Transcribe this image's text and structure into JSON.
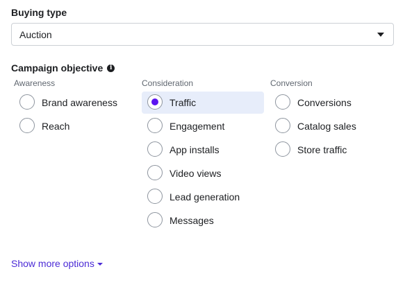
{
  "buying_type": {
    "title": "Buying type",
    "selected": "Auction"
  },
  "objective": {
    "title": "Campaign objective",
    "info_icon": "info-icon",
    "columns": {
      "awareness": {
        "header": "Awareness",
        "options": [
          "Brand awareness",
          "Reach"
        ]
      },
      "consideration": {
        "header": "Consideration",
        "options": [
          "Traffic",
          "Engagement",
          "App installs",
          "Video views",
          "Lead generation",
          "Messages"
        ]
      },
      "conversion": {
        "header": "Conversion",
        "options": [
          "Conversions",
          "Catalog sales",
          "Store traffic"
        ]
      }
    },
    "selected": "Traffic",
    "colors": {
      "selected_bg": "#e7edfa",
      "radio_dot": "#5b14f0",
      "link": "#4b2bd6"
    }
  },
  "show_more": {
    "label": "Show more options"
  }
}
